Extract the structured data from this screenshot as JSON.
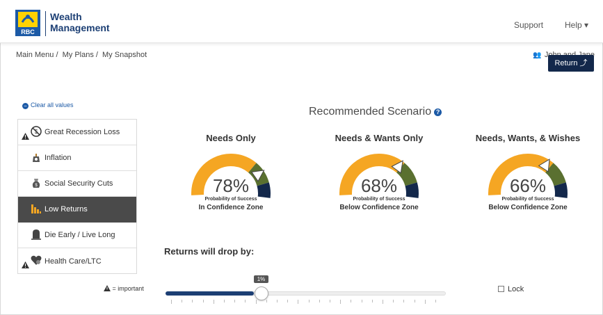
{
  "header": {
    "logo_text": "RBC",
    "brand_line1": "Wealth",
    "brand_line2": "Management",
    "nav": {
      "support": "Support",
      "help": "Help ▾"
    }
  },
  "breadcrumb": [
    "Main Menu /",
    "My Plans /",
    "My Snapshot"
  ],
  "user": {
    "name": "John and Jane"
  },
  "return_button": "Return ⤴",
  "clear_all": "Clear all values",
  "sidebar": {
    "items": [
      {
        "label": "Great Recession Loss",
        "icon": "recession-icon",
        "important": true
      },
      {
        "label": "Inflation",
        "icon": "inflation-icon",
        "important": false
      },
      {
        "label": "Social Security Cuts",
        "icon": "money-bag-icon",
        "important": false
      },
      {
        "label": "Low Returns",
        "icon": "bar-chart-icon",
        "important": false,
        "active": true
      },
      {
        "label": "Die Early / Live Long",
        "icon": "tombstone-icon",
        "important": false
      },
      {
        "label": "Health Care/LTC",
        "icon": "heart-icon",
        "important": true
      }
    ],
    "important_note": "= important"
  },
  "recommended": {
    "title": "Recommended Scenario"
  },
  "gauges": [
    {
      "title": "Needs Only",
      "percent": "78%",
      "subtitle": "Probability of Success",
      "zone": "In Confidence Zone",
      "value": 0.78
    },
    {
      "title": "Needs & Wants Only",
      "percent": "68%",
      "subtitle": "Probability of Success",
      "zone": "Below Confidence Zone",
      "value": 0.68
    },
    {
      "title": "Needs, Wants, & Wishes",
      "percent": "66%",
      "subtitle": "Probability of Success",
      "zone": "Below Confidence Zone",
      "value": 0.66
    }
  ],
  "colors": {
    "orange": "#f5a623",
    "green": "#5a7030",
    "navy": "#13284b",
    "accent": "#1c5aa6"
  },
  "slider": {
    "label": "Returns will drop by:",
    "value_label": "1%",
    "value": 0.34
  },
  "lock": "Lock"
}
